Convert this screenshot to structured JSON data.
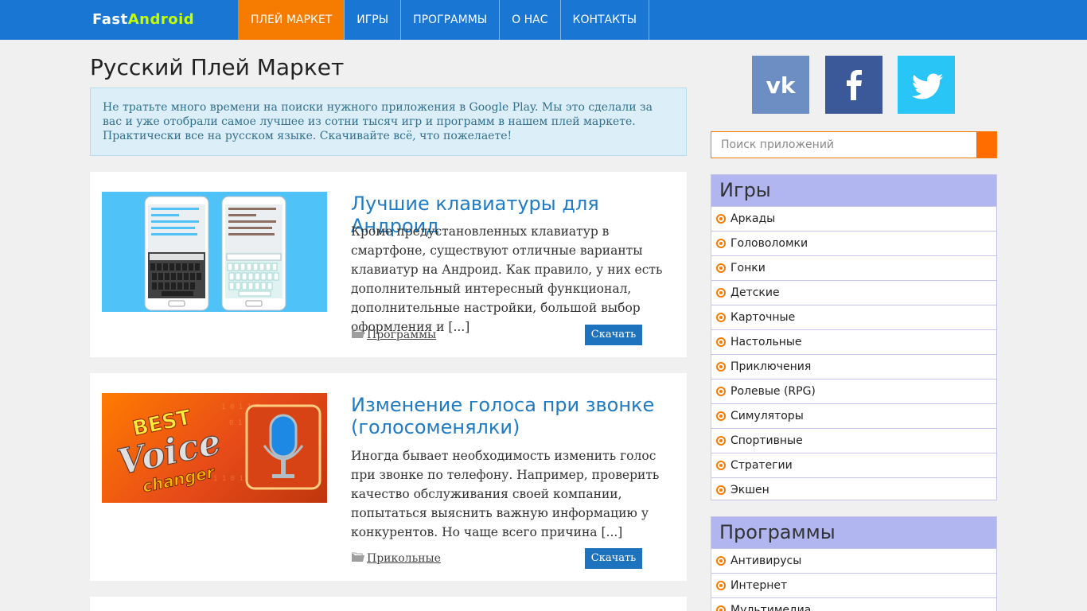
{
  "header": {
    "logo_part1": "Fast",
    "logo_part2": "Android",
    "nav": [
      "ПЛЕЙ МАРКЕТ",
      "ИГРЫ",
      "ПРОГРАММЫ",
      "О НАС",
      "КОНТАКТЫ"
    ]
  },
  "main": {
    "page_title": "Русский Плей Маркет",
    "intro": "Не тратьте много времени на поиски нужного приложения в Google Play. Мы это сделали за вас и уже отобрали самое лучшее из сотни тысяч игр и программ в нашем плей маркете. Практически все на русском языке. Скачивайте всё, что пожелаете!",
    "articles": [
      {
        "title": "Лучшие клавиатуры для Андроид",
        "excerpt": "Кроме предустановленных клавиатур в смартфоне, существуют отличные варианты клавиатур на Андроид. Как правило, у них есть дополнительный интересный функционал, дополнительные настройки, большой выбор оформления и [...]",
        "category": "Программы",
        "button": "Скачать"
      },
      {
        "title": "Изменение голоса при звонке (голосоменялки)",
        "excerpt": "Иногда бывает необходимость изменить голос при звонке по телефону. Например, проверить качество обслуживания своей компании, попытаться выяснить важную информацию у конкурентов. Но чаще всего причина [...]",
        "category": "Прикольные",
        "button": "Скачать",
        "image_text": [
          "BEST",
          "Voice",
          "changer"
        ]
      }
    ]
  },
  "sidebar": {
    "social": [
      "vk-icon",
      "facebook-icon",
      "twitter-icon"
    ],
    "search_placeholder": "Поиск приложений",
    "games": {
      "title": "Игры",
      "items": [
        "Аркады",
        "Головоломки",
        "Гонки",
        "Детские",
        "Карточные",
        "Настольные",
        "Приключения",
        "Ролевые (RPG)",
        "Симуляторы",
        "Спортивные",
        "Стратегии",
        "Экшен"
      ]
    },
    "programs": {
      "title": "Программы",
      "items": [
        "Антивирусы",
        "Интернет",
        "Мультимедиа"
      ]
    }
  },
  "colors": {
    "header": "#1976d2",
    "accent": "#f57c00",
    "link": "#1e7bc4",
    "widget_title": "#b1b6f1"
  }
}
